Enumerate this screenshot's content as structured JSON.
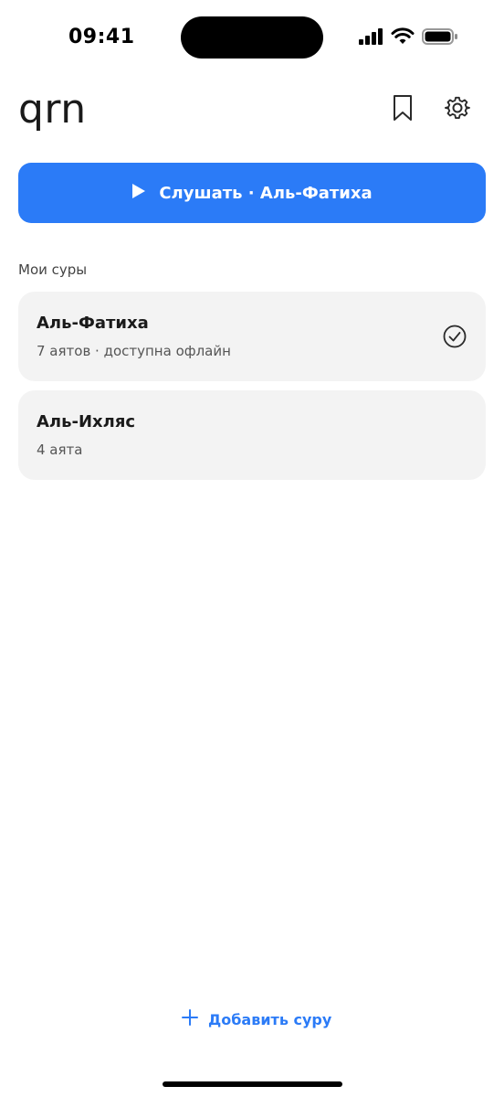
{
  "status_bar": {
    "time": "09:41",
    "icons": [
      "signal-icon",
      "wifi-icon",
      "battery-icon"
    ]
  },
  "header": {
    "title": "qrn",
    "icons": [
      "bookmark-icon",
      "gear-icon"
    ]
  },
  "play": {
    "label": "Слушать · Аль-Фатиха",
    "icon": "play-icon",
    "color": "#2b7bf7"
  },
  "surahs": {
    "heading": "Мои суры",
    "items": [
      {
        "name": "Аль-Фатиха",
        "meta": "7 аятов · доступна офлайн",
        "status_icon": "check-circle-icon"
      },
      {
        "name": "Аль-Ихляс",
        "meta": "4 аята"
      }
    ]
  },
  "footer": {
    "add_label": "Добавить суру",
    "add_icon": "plus-icon"
  }
}
